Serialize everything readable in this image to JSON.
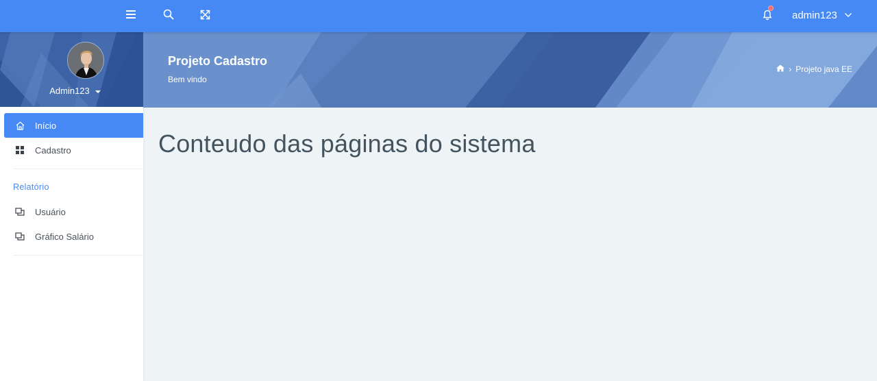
{
  "topbar": {
    "user_name": "admin123",
    "icons": [
      "menu-icon",
      "search-icon",
      "fullscreen-icon",
      "bell-icon",
      "chevron-down-icon"
    ],
    "background_color": "#4689f4",
    "notification_dot_color": "#f06e6e"
  },
  "profile": {
    "name": "Admin123"
  },
  "sidebar": {
    "items": [
      {
        "label": "Início",
        "icon": "home-icon",
        "active": true
      },
      {
        "label": "Cadastro",
        "icon": "grid-icon",
        "active": false
      }
    ],
    "section_label": "Relatório",
    "report_items": [
      {
        "label": "Usuário",
        "icon": "windows-icon"
      },
      {
        "label": "Gráfico Salário",
        "icon": "windows-icon"
      }
    ],
    "accent_color": "#4689f4"
  },
  "banner": {
    "title": "Projeto Cadastro",
    "subtitle": "Bem vindo",
    "breadcrumb": "Projeto java EE"
  },
  "main": {
    "heading": "Conteudo das páginas do sistema"
  }
}
